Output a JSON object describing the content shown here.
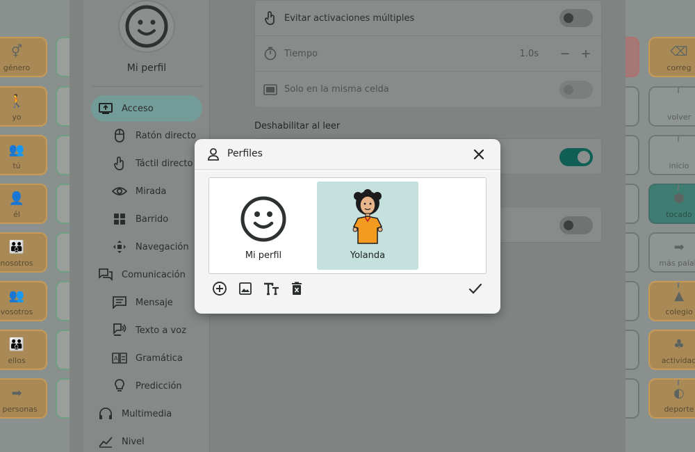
{
  "board": {
    "left_cells": [
      {
        "label": "género",
        "glyph": "⚥"
      },
      {
        "label": "yo",
        "glyph": "🚶"
      },
      {
        "label": "tú",
        "glyph": "👥"
      },
      {
        "label": "él",
        "glyph": "👤"
      },
      {
        "label": "nosotros",
        "glyph": "👪"
      },
      {
        "label": "vosotros",
        "glyph": "👥"
      },
      {
        "label": "ellos",
        "glyph": "👪"
      },
      {
        "label": "s personas",
        "glyph": "➡"
      }
    ],
    "right_cells": [
      {
        "label": "correg",
        "glyph": "⌫"
      },
      {
        "label": "volver",
        "glyph": ""
      },
      {
        "label": "inicio",
        "glyph": ""
      },
      {
        "label": "tocado",
        "glyph": "⬢"
      },
      {
        "label": "más palab",
        "glyph": "➡"
      },
      {
        "label": "colegio",
        "glyph": "▲"
      },
      {
        "label": "actividad",
        "glyph": "♣"
      },
      {
        "label": "deporte",
        "glyph": "◐"
      }
    ]
  },
  "sidebar": {
    "profile_name": "Mi perfil",
    "items": [
      {
        "label": "Acceso",
        "icon": "screen-icon",
        "active": true,
        "sub": false
      },
      {
        "label": "Ratón directo",
        "icon": "mouse-icon",
        "sub": true
      },
      {
        "label": "Táctil directo",
        "icon": "touch-icon",
        "sub": true
      },
      {
        "label": "Mirada",
        "icon": "eye-icon",
        "sub": true
      },
      {
        "label": "Barrido",
        "icon": "grid-icon",
        "sub": true
      },
      {
        "label": "Navegación",
        "icon": "move-icon",
        "sub": true
      },
      {
        "label": "Comunicación",
        "icon": "chat-icon",
        "sub": false
      },
      {
        "label": "Mensaje",
        "icon": "message-icon",
        "sub": true
      },
      {
        "label": "Texto a voz",
        "icon": "speech-icon",
        "sub": true
      },
      {
        "label": "Gramática",
        "icon": "grammar-icon",
        "sub": true
      },
      {
        "label": "Predicción",
        "icon": "bulb-icon",
        "sub": true
      },
      {
        "label": "Multimedia",
        "icon": "headphones-icon",
        "sub": false
      },
      {
        "label": "Nivel",
        "icon": "level-icon",
        "sub": false
      }
    ]
  },
  "settings": {
    "rows": [
      {
        "label": "Evitar activaciones múltiples",
        "icon": "touch-icon"
      },
      {
        "label": "Tiempo",
        "icon": "timer-icon",
        "value": "1.0s"
      },
      {
        "label": "Solo en la misma celda",
        "icon": "cell-icon"
      }
    ],
    "section_title": "Deshabilitar al leer"
  },
  "modal": {
    "title": "Perfiles",
    "profiles": [
      {
        "label": "Mi perfil",
        "selected": false
      },
      {
        "label": "Yolanda",
        "selected": true
      }
    ]
  },
  "colors": {
    "accent": "#1e9a8a",
    "selected_bg": "#c4e1de",
    "active_nav": "#739b97"
  }
}
